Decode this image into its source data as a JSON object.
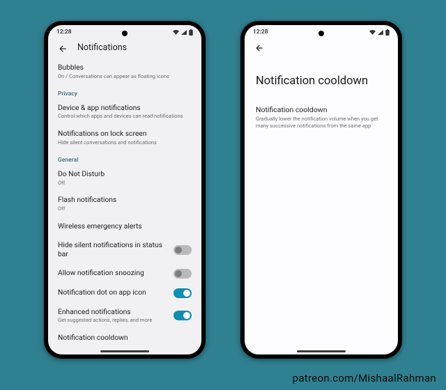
{
  "credit": "patreon.com/MishaalRahman",
  "status": {
    "time": "12:28",
    "dnd_icon": true
  },
  "left": {
    "title": "Notifications",
    "rows": [
      {
        "kind": "item",
        "title": "Bubbles",
        "sub": "On / Conversations can appear as floating icons"
      },
      {
        "kind": "section",
        "label": "Privacy"
      },
      {
        "kind": "item",
        "title": "Device & app notifications",
        "sub": "Control which apps and devices can read notifications"
      },
      {
        "kind": "item",
        "title": "Notifications on lock screen",
        "sub": "Hide silent conversations and notifications"
      },
      {
        "kind": "section",
        "label": "General"
      },
      {
        "kind": "item",
        "title": "Do Not Disturb",
        "sub": "Off"
      },
      {
        "kind": "item",
        "title": "Flash notifications",
        "sub": "Off"
      },
      {
        "kind": "item",
        "title": "Wireless emergency alerts"
      },
      {
        "kind": "toggle",
        "title": "Hide silent notifications in status bar",
        "on": false
      },
      {
        "kind": "toggle",
        "title": "Allow notification snoozing",
        "on": false
      },
      {
        "kind": "toggle",
        "title": "Notification dot on app icon",
        "on": true
      },
      {
        "kind": "toggle",
        "title": "Enhanced notifications",
        "sub": "Get suggested actions, replies, and more",
        "on": true
      },
      {
        "kind": "item",
        "title": "Notification cooldown"
      }
    ]
  },
  "right": {
    "big_title": "Notification cooldown",
    "item_title": "Notification cooldown",
    "item_sub": "Gradually lower the notification volume when you get many successive notifications from the same app"
  }
}
